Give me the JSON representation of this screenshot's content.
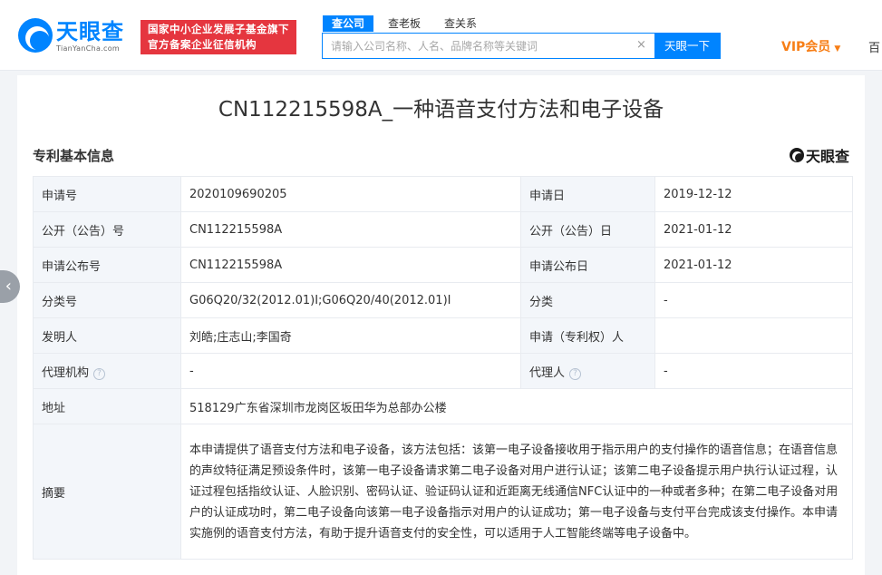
{
  "header": {
    "logo_cn": "天眼查",
    "logo_en": "TianYanCha.com",
    "badge_line1": "国家中小企业发展子基金旗下",
    "badge_line2": "官方备案企业征信机构",
    "tabs": [
      {
        "label": "查公司",
        "active": true
      },
      {
        "label": "查老板",
        "active": false
      },
      {
        "label": "查关系",
        "active": false
      }
    ],
    "search_placeholder": "请输入公司名称、人名、品牌名称等关键词",
    "clear_symbol": "×",
    "search_button": "天眼一下",
    "vip_label": "VIP会员",
    "vip_arrow": "▼",
    "truncated_text": "百"
  },
  "page": {
    "title": "CN112215598A_一种语音支付方法和电子设备",
    "section_title": "专利基本信息",
    "brand": "天眼查",
    "prev_symbol": "‹"
  },
  "patent": {
    "rows": [
      {
        "l1": "申请号",
        "v1": "2020109690205",
        "l2": "申请日",
        "v2": "2019-12-12"
      },
      {
        "l1": "公开（公告）号",
        "v1": "CN112215598A",
        "l2": "公开（公告）日",
        "v2": "2021-01-12"
      },
      {
        "l1": "申请公布号",
        "v1": "CN112215598A",
        "l2": "申请公布日",
        "v2": "2021-01-12"
      },
      {
        "l1": "分类号",
        "v1": "G06Q20/32(2012.01)I;G06Q20/40(2012.01)I",
        "l2": "分类",
        "v2": "-"
      },
      {
        "l1": "发明人",
        "v1": "刘皓;庄志山;李国奇",
        "l2": "申请（专利权）人",
        "v2": ""
      },
      {
        "l1": "代理机构",
        "v1": "-",
        "l2": "代理人",
        "v2": "-"
      }
    ],
    "help_symbol": "?",
    "address_label": "地址",
    "address_value": "518129广东省深圳市龙岗区坂田华为总部办公楼",
    "abstract_label": "摘要",
    "abstract_value": "本申请提供了语音支付方法和电子设备，该方法包括：该第一电子设备接收用于指示用户的支付操作的语音信息；在语音信息的声纹特征满足预设条件时，该第一电子设备请求第二电子设备对用户进行认证；该第二电子设备提示用户执行认证过程，认证过程包括指纹认证、人脸识别、密码认证、验证码认证和近距离无线通信NFC认证中的一种或者多种；在第二电子设备对用户的认证成功时，第二电子设备向该第一电子设备指示对用户的认证成功；第一电子设备与支付平台完成该支付操作。本申请实施例的语音支付方法，有助于提升语音支付的安全性，可以适用于人工智能终端等电子设备中。"
  },
  "colors": {
    "brand_blue": "#0084ff",
    "badge_red": "#e5363f",
    "vip_orange": "#f77e16",
    "label_bg": "#f3f6fa"
  }
}
